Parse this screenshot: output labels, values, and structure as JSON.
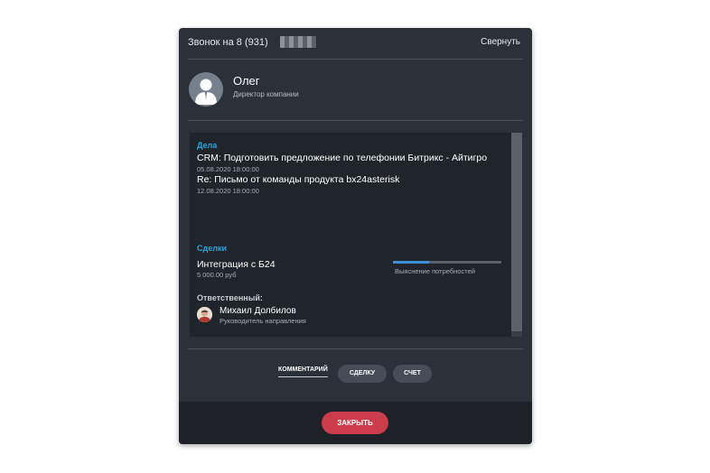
{
  "header": {
    "title": "Звонок на 8 (931)",
    "collapse_label": "Свернуть"
  },
  "contact": {
    "name": "Олег",
    "position": "Директор компании"
  },
  "tasks": {
    "section_label": "Дела",
    "items": [
      {
        "title": "CRM: Подготовить предложение по телефонии Битрикс - Айтигро",
        "date": "05.08.2020 18:00:00"
      },
      {
        "title": "Re: Письмо от команды продукта bx24asterisk",
        "date": "12.08.2020 18:00:00"
      }
    ]
  },
  "deals": {
    "section_label": "Сделки",
    "items": [
      {
        "title": "Интеграция с Б24",
        "amount": "5 000.00 руб",
        "stage": "Выяснение потребностей",
        "stage_progress": 0.33
      }
    ]
  },
  "responsible": {
    "label": "Ответственный:",
    "name": "Михаил Долбилов",
    "position": "Руководитель направления"
  },
  "tabs": {
    "comment": "КОММЕНТАРИЙ",
    "deal": "СДЕЛКУ",
    "invoice": "СЧЕТ"
  },
  "footer": {
    "close_label": "ЗАКРЫТЬ"
  },
  "colors": {
    "card": "#2b3039",
    "panel": "#20242b",
    "accent": "#2aa6dc",
    "close": "#cb3d4a",
    "progress": "#3d8fd6"
  },
  "icons": {
    "contact_avatar": "person-icon",
    "responsible_avatar": "person-photo"
  }
}
